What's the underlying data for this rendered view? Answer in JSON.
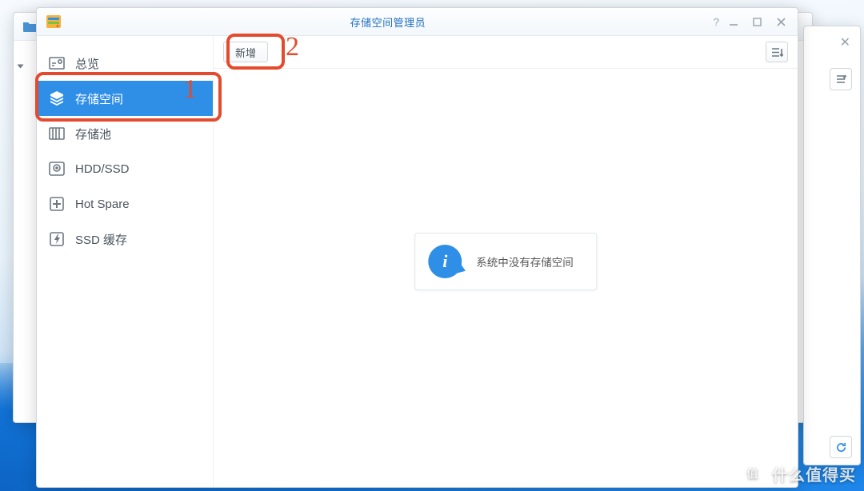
{
  "window": {
    "title": "存储空间管理员"
  },
  "sidebar": {
    "items": [
      {
        "label": "总览"
      },
      {
        "label": "存储空间"
      },
      {
        "label": "存储池"
      },
      {
        "label": "HDD/SSD"
      },
      {
        "label": "Hot Spare"
      },
      {
        "label": "SSD 缓存"
      }
    ],
    "active_index": 1
  },
  "toolbar": {
    "add_label": "新增"
  },
  "empty_state": {
    "message": "系统中没有存储空间"
  },
  "annotations": {
    "n1": "1",
    "n2": "2"
  },
  "watermark": {
    "badge": "值",
    "text": "什么值得买"
  }
}
